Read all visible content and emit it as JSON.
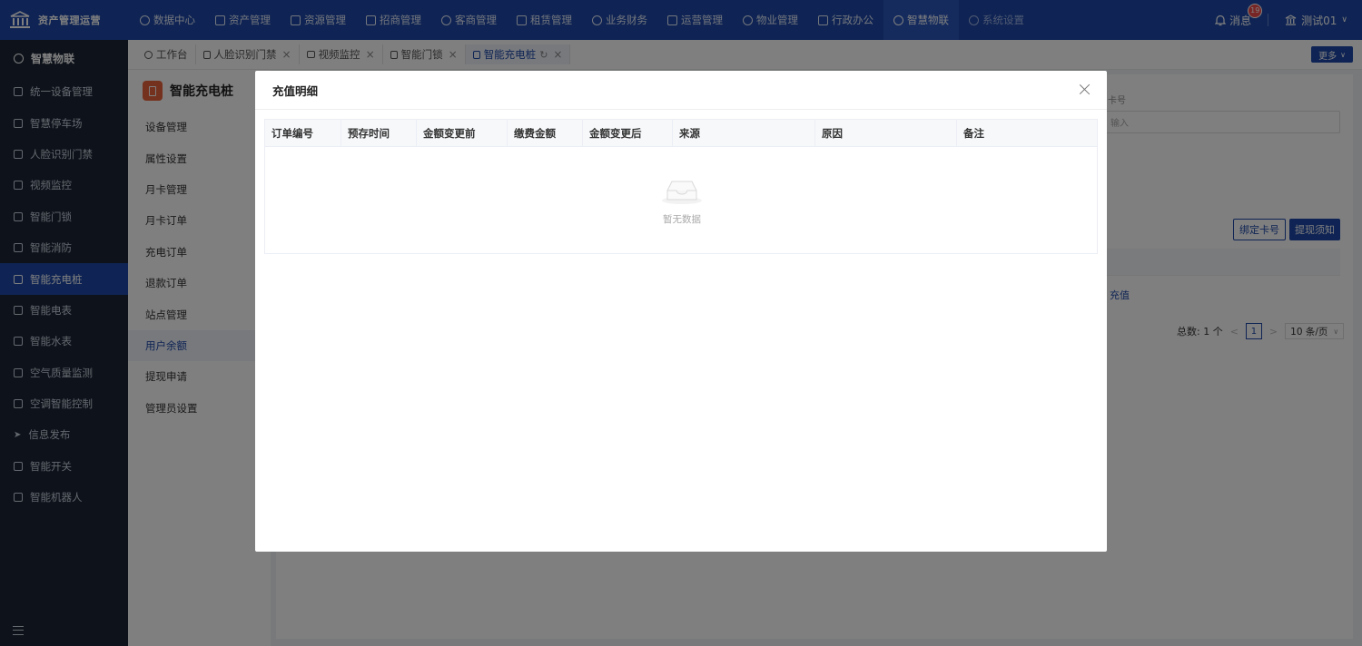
{
  "app": {
    "title": "资产管理运营"
  },
  "topnav": [
    {
      "label": "数据中心"
    },
    {
      "label": "资产管理"
    },
    {
      "label": "资源管理"
    },
    {
      "label": "招商管理"
    },
    {
      "label": "客商管理"
    },
    {
      "label": "租赁管理"
    },
    {
      "label": "业务财务"
    },
    {
      "label": "运营管理"
    },
    {
      "label": "物业管理"
    },
    {
      "label": "行政办公"
    },
    {
      "label": "智慧物联"
    },
    {
      "label": "系统设置"
    }
  ],
  "header": {
    "messages_label": "消息",
    "messages_count": "19",
    "username": "测试01"
  },
  "sidebar": {
    "head": "智慧物联",
    "items": [
      {
        "label": "统一设备管理"
      },
      {
        "label": "智慧停车场"
      },
      {
        "label": "人脸识别门禁"
      },
      {
        "label": "视频监控"
      },
      {
        "label": "智能门锁"
      },
      {
        "label": "智能消防"
      },
      {
        "label": "智能充电桩"
      },
      {
        "label": "智能电表"
      },
      {
        "label": "智能水表"
      },
      {
        "label": "空气质量监测"
      },
      {
        "label": "空调智能控制"
      },
      {
        "label": "信息发布"
      },
      {
        "label": "智能开关"
      },
      {
        "label": "智能机器人"
      }
    ]
  },
  "tabs": [
    {
      "label": "工作台"
    },
    {
      "label": "人脸识别门禁"
    },
    {
      "label": "视频监控"
    },
    {
      "label": "智能门锁"
    },
    {
      "label": "智能充电桩"
    }
  ],
  "more_label": "更多",
  "subpanel": {
    "title": "智能充电桩",
    "items": [
      {
        "label": "设备管理"
      },
      {
        "label": "属性设置"
      },
      {
        "label": "月卡管理"
      },
      {
        "label": "月卡订单"
      },
      {
        "label": "充电订单"
      },
      {
        "label": "退款订单"
      },
      {
        "label": "站点管理"
      },
      {
        "label": "用户余额"
      },
      {
        "label": "提现申请"
      },
      {
        "label": "管理员设置"
      }
    ]
  },
  "background": {
    "field_label_partial": "卡号",
    "input_placeholder_partial": "输入",
    "btn_bind": "绑定卡号",
    "btn_notice": "提现须知",
    "row_link_partial": "充值",
    "pager_total": "总数: 1 个",
    "pager_page": "1",
    "pager_size": "10 条/页"
  },
  "modal": {
    "title": "充值明细",
    "columns": [
      "订单编号",
      "预存时间",
      "金额变更前",
      "缴费金额",
      "金额变更后",
      "来源",
      "原因",
      "备注"
    ],
    "empty_text": "暂无数据"
  }
}
